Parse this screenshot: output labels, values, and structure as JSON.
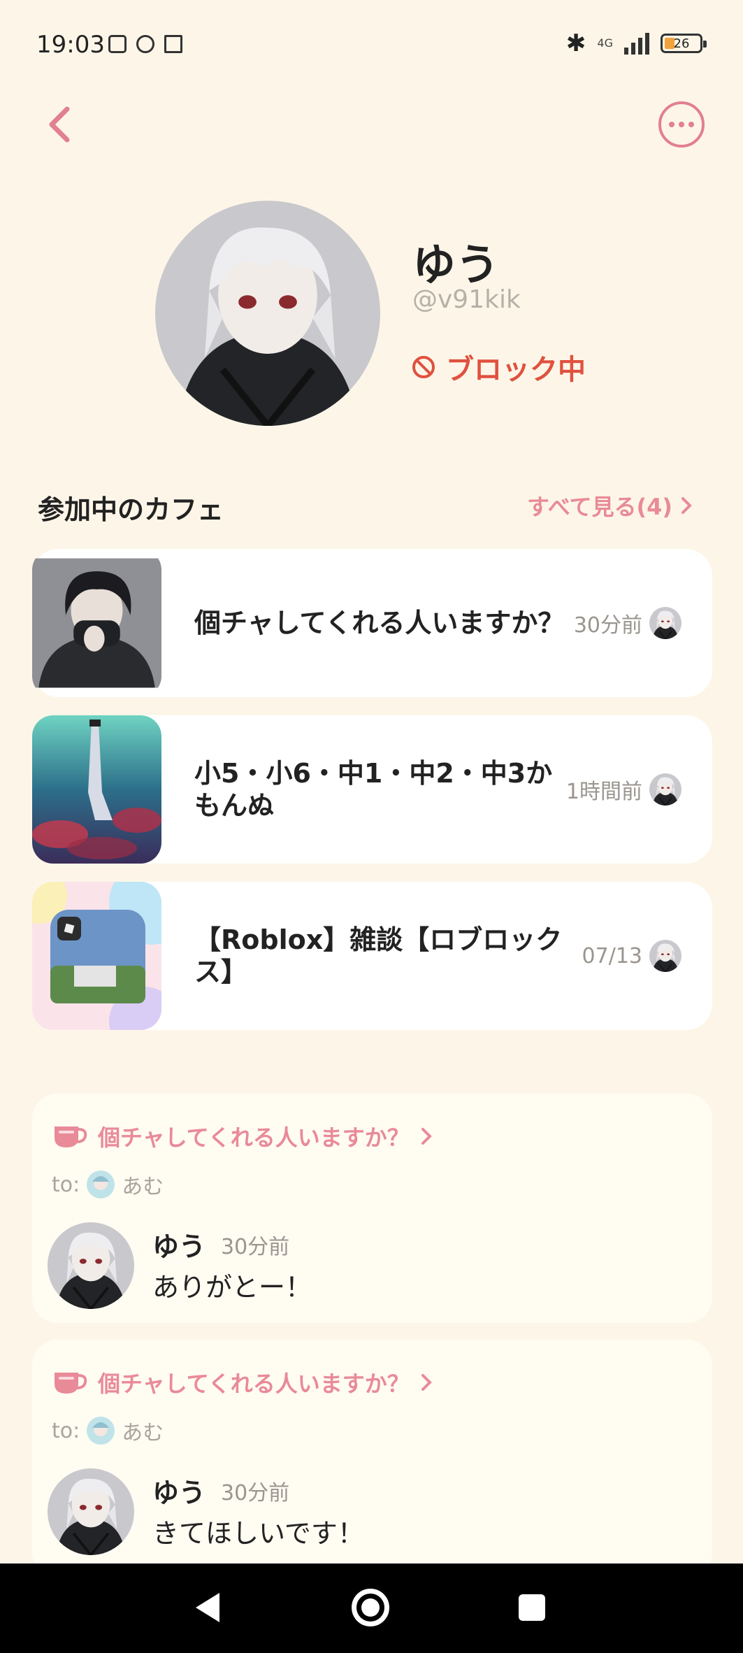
{
  "status": {
    "time": "19:03",
    "network": "4G",
    "battery": "26",
    "icons": [
      "plus-box-icon",
      "game-icon",
      "calendar-icon",
      "bluetooth-icon",
      "signal-icon",
      "battery-icon"
    ]
  },
  "header": {
    "back_icon": "chevron-left-icon",
    "more_icon": "ellipsis-icon"
  },
  "profile": {
    "name": "ゆう",
    "handle": "@v91kik",
    "block_label": "ブロック中",
    "block_icon": "block-icon"
  },
  "cafes": {
    "section_title": "参加中のカフェ",
    "see_all": "すべて見る(4)",
    "items": [
      {
        "title": "個チャしてくれる人いますか？",
        "time": "30分前"
      },
      {
        "title": "小5・小6・中1・中2・中3かもんぬ",
        "time": "1時間前"
      },
      {
        "title": "【Roblox】雑談【ロブロックス】",
        "time": "07/13"
      }
    ]
  },
  "feed": {
    "to_prefix": "to:",
    "items": [
      {
        "cafe": "個チャしてくれる人いますか？",
        "to": "あむ",
        "author": "ゆう",
        "time": "30分前",
        "text": "ありがとー！"
      },
      {
        "cafe": "個チャしてくれる人いますか？",
        "to": "あむ",
        "author": "ゆう",
        "time": "30分前",
        "text": "きてほしいです！"
      }
    ]
  },
  "colors": {
    "background": "#fdf6e8",
    "accent": "#e98a98",
    "block": "#e0513f"
  }
}
